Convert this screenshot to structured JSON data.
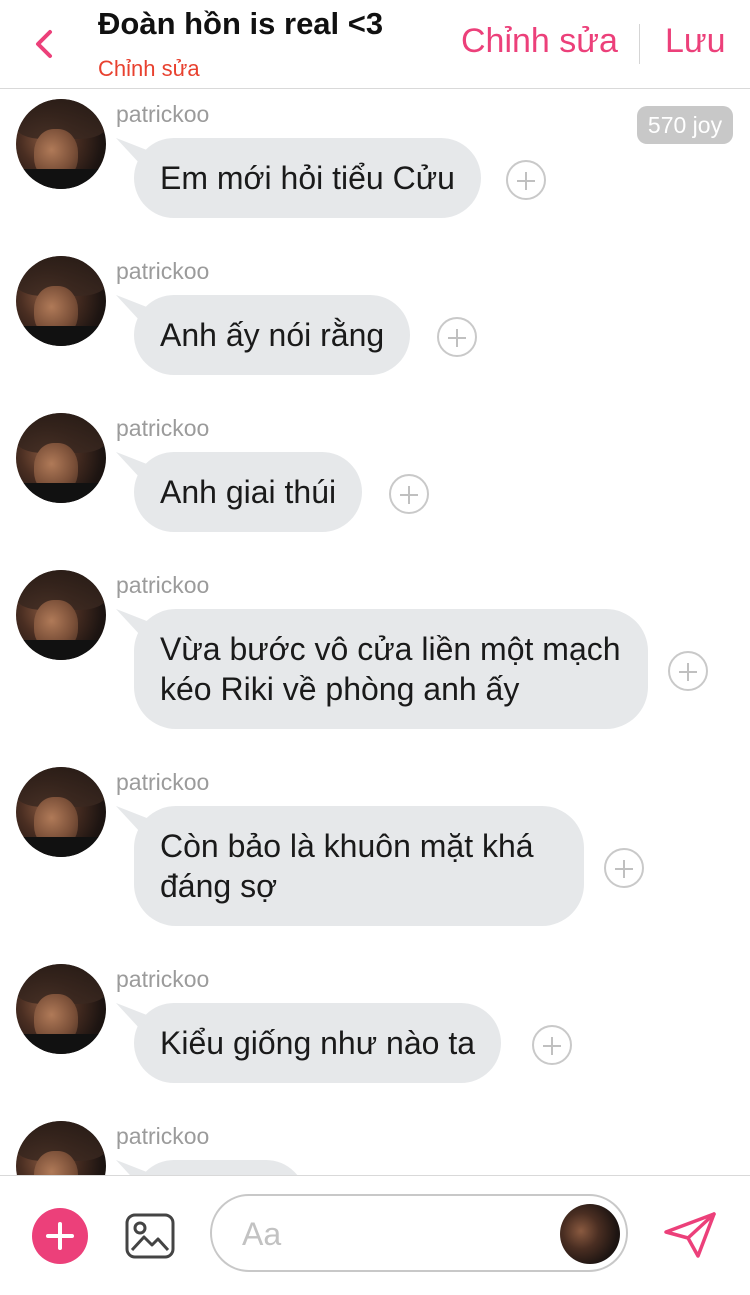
{
  "header": {
    "title": "Đoàn hồn is real <3",
    "subtitle": "Chỉnh sửa",
    "edit_label": "Chỉnh sửa",
    "save_label": "Lưu"
  },
  "badge": {
    "joy": "570 joy"
  },
  "messages": [
    {
      "user": "patrickoo",
      "text": "Em mới hỏi tiểu Cửu"
    },
    {
      "user": "patrickoo",
      "text": "Anh ấy nói rằng"
    },
    {
      "user": "patrickoo",
      "text": "Anh giai thúi"
    },
    {
      "user": "patrickoo",
      "text": "Vừa bước vô cửa liền một mạch kéo Riki về phòng anh ấy"
    },
    {
      "user": "patrickoo",
      "text": "Còn bảo là khuôn mặt khá đáng sợ"
    },
    {
      "user": "patrickoo",
      "text": "Kiểu giống như nào ta"
    },
    {
      "user": "patrickoo",
      "text": ""
    }
  ],
  "composer": {
    "placeholder": "Aa"
  },
  "icons": {
    "back": "chevron-left-icon",
    "add": "plus-icon",
    "image": "image-icon",
    "send": "send-icon"
  },
  "colors": {
    "accent": "#ec407a",
    "subtitle": "#e8412f",
    "bubble": "#e6e8ea"
  }
}
